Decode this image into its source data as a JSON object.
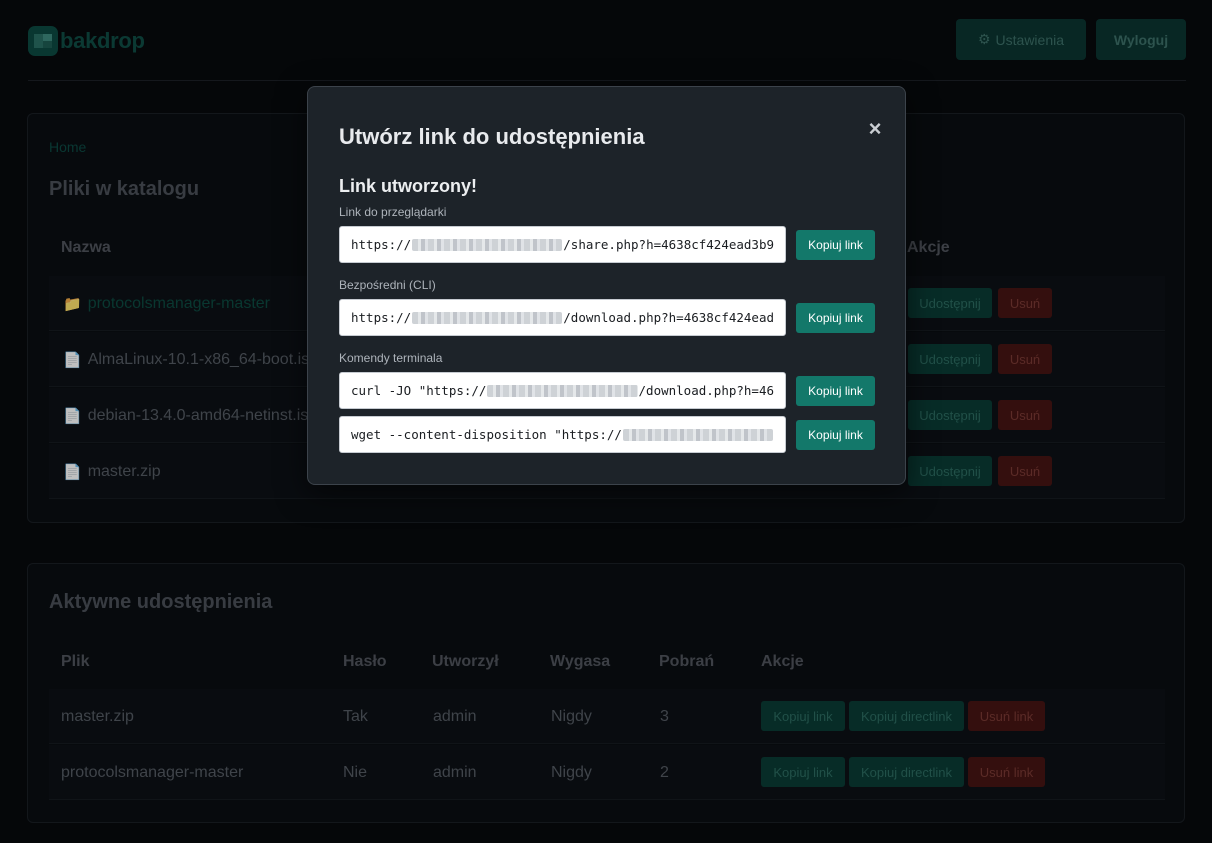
{
  "header": {
    "logo_text": "bakdrop",
    "settings_icon": "gear-icon",
    "settings_label": "Ustawienia",
    "logout_label": "Wyloguj"
  },
  "files_card": {
    "breadcrumb": "Home",
    "title": "Pliki w katalogu",
    "columns": {
      "name": "Nazwa",
      "actions": "Akcje"
    },
    "share_label": "Udostępnij",
    "delete_label": "Usuń",
    "rows": [
      {
        "icon": "folder-icon",
        "name": "protocolsmanager-master"
      },
      {
        "icon": "file-icon",
        "name": "AlmaLinux-10.1-x86_64-boot.iso"
      },
      {
        "icon": "file-icon",
        "name": "debian-13.4.0-amd64-netinst.iso"
      },
      {
        "icon": "file-icon",
        "name": "master.zip"
      }
    ]
  },
  "shares_card": {
    "title": "Aktywne udostępnienia",
    "columns": [
      "Plik",
      "Hasło",
      "Utworzył",
      "Wygasa",
      "Pobrań",
      "Akcje"
    ],
    "copy_link_label": "Kopiuj link",
    "copy_direct_label": "Kopiuj directlink",
    "remove_link_label": "Usuń link",
    "rows": [
      {
        "file": "master.zip",
        "password": "Tak",
        "created_by": "admin",
        "expires": "Nigdy",
        "downloads": "3"
      },
      {
        "file": "protocolsmanager-master",
        "password": "Nie",
        "created_by": "admin",
        "expires": "Nigdy",
        "downloads": "2"
      }
    ]
  },
  "modal": {
    "title": "Utwórz link do udostępnienia",
    "close_icon": "close-icon",
    "close_glyph": "×",
    "created_heading": "Link utworzony!",
    "browser_label": "Link do przeglądarki",
    "direct_label": "Bezpośredni (CLI)",
    "terminal_label": "Komendy terminala",
    "copy_label": "Kopiuj link",
    "browser_link": {
      "prefix": "https://",
      "suffix": "/share.php?h=4638cf424ead3b9"
    },
    "direct_link": {
      "prefix": "https://",
      "suffix": "/download.php?h=4638cf424ead"
    },
    "curl_cmd": {
      "prefix": "curl -JO \"https://",
      "suffix": "/download.php?h=46"
    },
    "wget_cmd": {
      "prefix": "wget --content-disposition \"https://",
      "suffix": ""
    }
  }
}
